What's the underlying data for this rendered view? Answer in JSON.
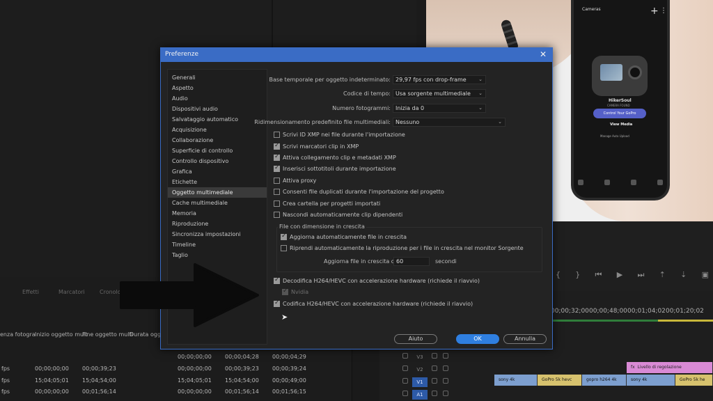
{
  "dialog": {
    "title": "Preferenze",
    "close_glyph": "✕",
    "categories": [
      {
        "label": "Generali",
        "selected": false
      },
      {
        "label": "Aspetto",
        "selected": false
      },
      {
        "label": "Audio",
        "selected": false
      },
      {
        "label": "Dispositivi audio",
        "selected": false
      },
      {
        "label": "Salvataggio automatico",
        "selected": false
      },
      {
        "label": "Acquisizione",
        "selected": false
      },
      {
        "label": "Collaborazione",
        "selected": false
      },
      {
        "label": "Superficie di controllo",
        "selected": false
      },
      {
        "label": "Controllo dispositivo",
        "selected": false
      },
      {
        "label": "Grafica",
        "selected": false
      },
      {
        "label": "Etichette",
        "selected": false
      },
      {
        "label": "Oggetto multimediale",
        "selected": true
      },
      {
        "label": "Cache multimediale",
        "selected": false
      },
      {
        "label": "Memoria",
        "selected": false
      },
      {
        "label": "Riproduzione",
        "selected": false
      },
      {
        "label": "Sincronizza impostazioni",
        "selected": false
      },
      {
        "label": "Timeline",
        "selected": false
      },
      {
        "label": "Taglio",
        "selected": false
      }
    ],
    "fields": {
      "timebase_label": "Base temporale per oggetto indeterminato:",
      "timebase_value": "29,97  fps con drop-frame",
      "timecode_label": "Codice di tempo:",
      "timecode_value": "Usa sorgente multimediale",
      "framenum_label": "Numero fotogrammi:",
      "framenum_value": "Inizia da 0",
      "resize_label": "Ridimensionamento predefinito file multimediali:",
      "resize_value": "Nessuno"
    },
    "checkboxes": [
      {
        "label": "Scrivi ID XMP nei file durante l'importazione",
        "checked": false
      },
      {
        "label": "Scrivi marcatori clip in XMP",
        "checked": true
      },
      {
        "label": "Attiva collegamento clip e metadati XMP",
        "checked": true
      },
      {
        "label": "Inserisci sottotitoli durante importazione",
        "checked": true
      },
      {
        "label": "Attiva proxy",
        "checked": false
      },
      {
        "label": "Consenti file duplicati durante l'importazione del progetto",
        "checked": false
      },
      {
        "label": "Crea cartella per progetti importati",
        "checked": false
      },
      {
        "label": "Nascondi automaticamente clip dipendenti",
        "checked": false
      }
    ],
    "growing": {
      "legend": "File con dimensione in crescita",
      "auto_update": {
        "label": "Aggiorna automaticamente file in crescita",
        "checked": true
      },
      "resume": {
        "label": "Riprendi automaticamente la riproduzione per i file in crescita nel monitor Sorgente",
        "checked": false
      },
      "refresh_label": "Aggiorna file in crescita ogni",
      "refresh_value": "60",
      "refresh_unit": "secondi"
    },
    "hw": {
      "decode": {
        "label": "Decodifica H264/HEVC con accelerazione hardware (richiede il riavvio)",
        "checked": true
      },
      "nvidia": {
        "label": "Nvidia",
        "checked": true
      },
      "encode": {
        "label": "Codifica H264/HEVC con accelerazione hardware (richiede il riavvio)",
        "checked": true
      }
    },
    "buttons": {
      "help": "Aiuto",
      "ok": "OK",
      "cancel": "Annulla"
    }
  },
  "phone": {
    "title": "Cameras",
    "plus": "+",
    "dots": "⋮",
    "device_name": "HikerSoul",
    "device_sub": "CAMERA FOUND",
    "control_btn": "Control Your GoPro",
    "view_media": "View Media",
    "upload": "Manage Auto Upload"
  },
  "project_panel": {
    "tabs": [
      "Effetti",
      "Marcatori",
      "Cronolo"
    ],
    "columns": [
      "enza fotogra",
      "Inizio oggetto mult",
      "Fine oggetto multi",
      "Durata ogget"
    ],
    "rows": [
      [
        "fps",
        "00;00;00;00",
        "00;00;39;23",
        "00;00;00;00",
        "00;00;39;23",
        "00;00;39;24"
      ],
      [
        "fps",
        "15;04;05;01",
        "15;04;54;00",
        "15;04;05;01",
        "15;04;54;00",
        "00;00;49;00"
      ],
      [
        "fps",
        "00;00;00;00",
        "00;01;56;14",
        "00;00;00;00",
        "00;01;56;14",
        "00;01;56;15"
      ]
    ],
    "top_row": [
      "00;00;00;00",
      "00;00;04;28",
      "00;00;04;29"
    ]
  },
  "timeline": {
    "ruler": [
      "00;00;32;00",
      "00;00;48;00",
      "00;01;04;02",
      "00;01;20;02"
    ],
    "tracks": [
      "V3",
      "V2",
      "V1",
      "A1"
    ],
    "clips_v1": [
      "sony 4k",
      "GoPro 5k hevc",
      "gopro h264 4k",
      "sony 4k",
      "GoPro 5k he"
    ],
    "clip_fx": "Livello di regolazione",
    "fx_badge": "fx"
  },
  "colors": {
    "accent": "#3a6cc5",
    "primary_button": "#2f7fe0",
    "dialog_bg": "#232323"
  }
}
